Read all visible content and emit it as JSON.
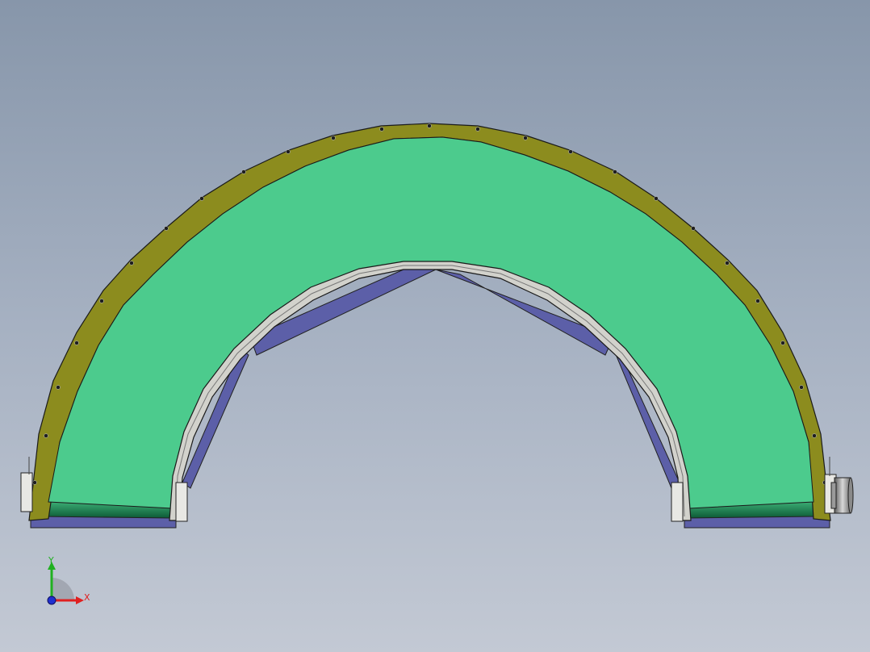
{
  "viewport": {
    "background_top": "#8796aa",
    "background_bottom": "#c3c9d4"
  },
  "model": {
    "belt_color": "#4ccb8d",
    "outer_rail_color": "#8c8c1e",
    "inner_rail_color": "#d2d2cc",
    "frame_color": "#5c5fa8",
    "motor": "motor-icon"
  },
  "triad": {
    "x_label": "X",
    "y_label": "Y",
    "x_color": "#e02020",
    "y_color": "#20b020",
    "z_color": "#2030d0"
  }
}
